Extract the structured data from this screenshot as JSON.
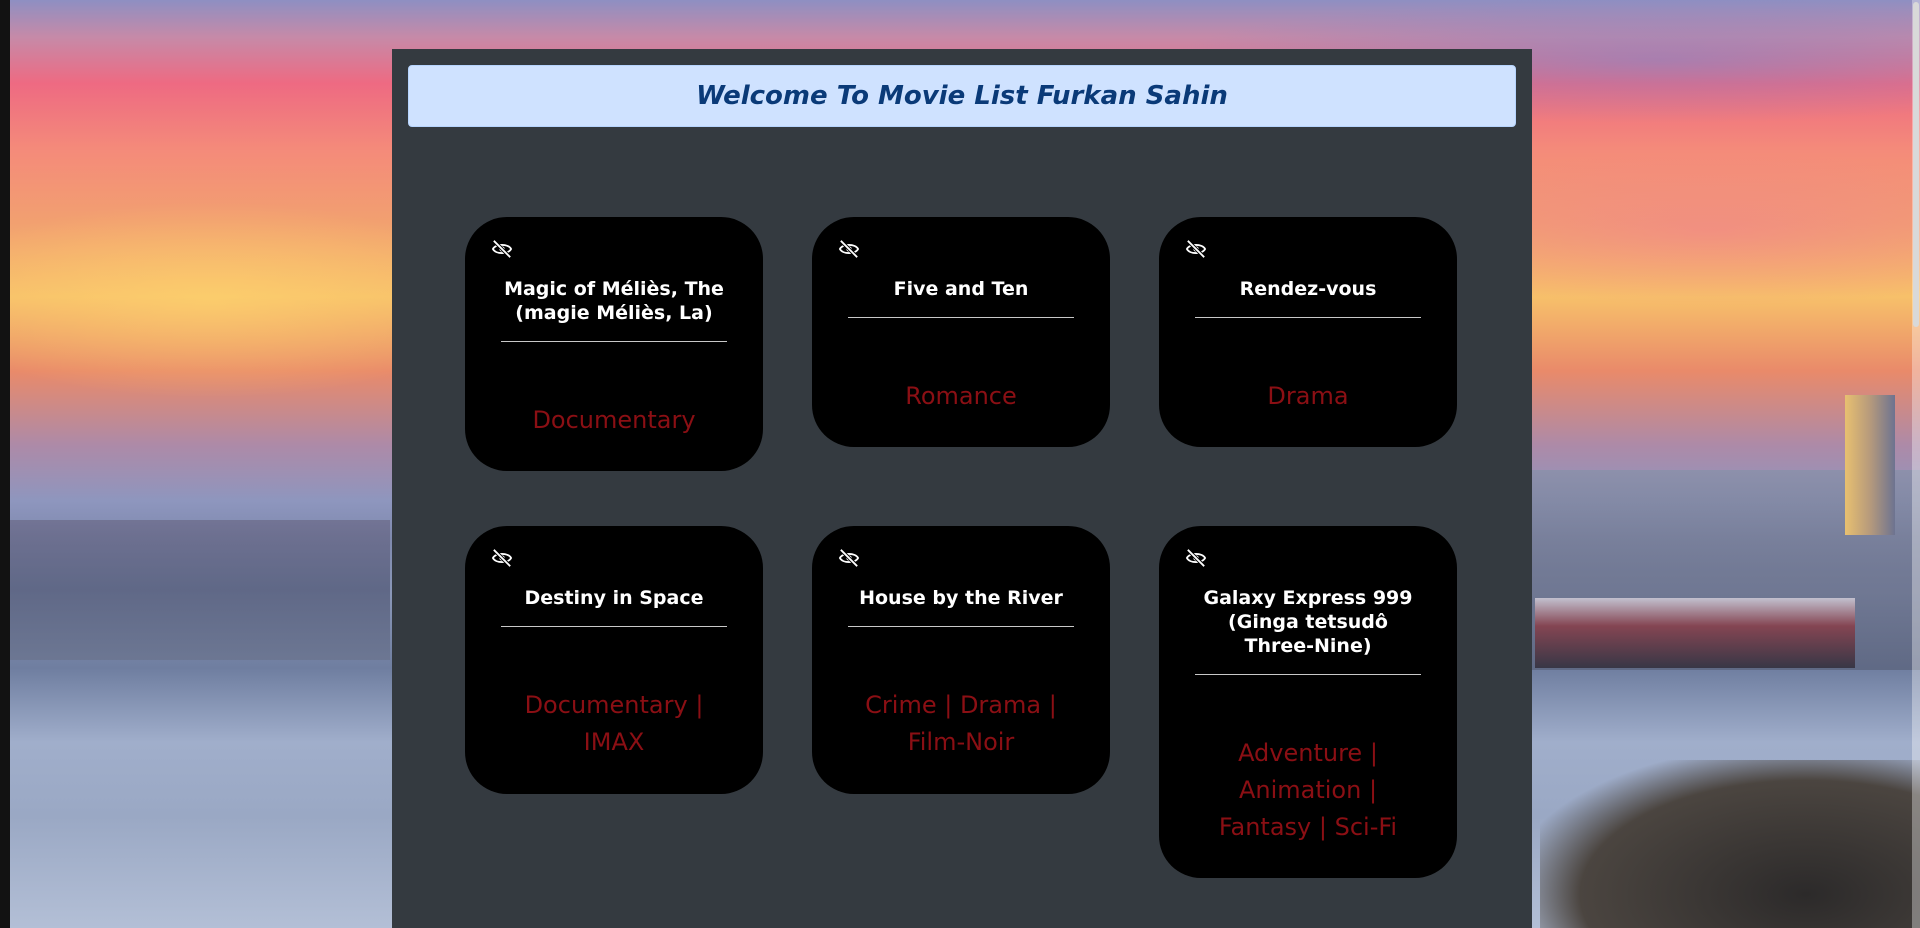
{
  "header": {
    "title": "Welcome To Movie List Furkan Sahin"
  },
  "icons": {
    "toggle": "eye-slash-icon"
  },
  "colors": {
    "header_bg": "#cfe2ff",
    "header_text": "#0a3a78",
    "panel": "#343a40",
    "card": "#000000",
    "genre_text": "#8b0f14"
  },
  "movies": [
    {
      "title": "Magic of Méliès, The (magie Méliès, La)",
      "genres": "Documentary"
    },
    {
      "title": "Five and Ten",
      "genres": "Romance"
    },
    {
      "title": "Rendez-vous",
      "genres": "Drama"
    },
    {
      "title": "Destiny in Space",
      "genres": "Documentary | IMAX"
    },
    {
      "title": "House by the River",
      "genres": "Crime | Drama | Film-Noir"
    },
    {
      "title": "Galaxy Express 999 (Ginga tetsudô Three-Nine)",
      "genres": "Adventure | Animation | Fantasy | Sci-Fi"
    }
  ]
}
